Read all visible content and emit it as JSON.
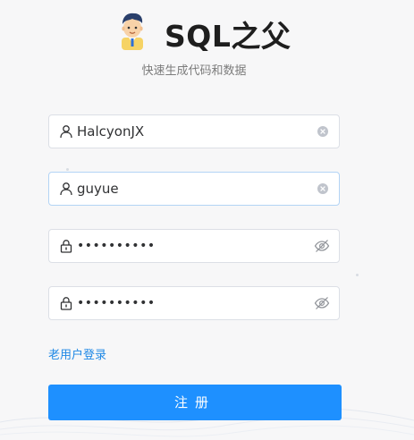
{
  "app": {
    "title": "SQL之父",
    "subtitle": "快速生成代码和数据"
  },
  "form": {
    "username": {
      "value": "HalcyonJX",
      "icon": "user-icon",
      "suffix_icon": "clear-icon"
    },
    "nickname": {
      "value": "guyue",
      "icon": "user-icon",
      "suffix_icon": "clear-icon"
    },
    "password": {
      "value": "••••••••••",
      "icon": "lock-icon",
      "suffix_icon": "eye-off-icon"
    },
    "confirm_password": {
      "value": "••••••••••",
      "icon": "lock-icon",
      "suffix_icon": "eye-off-icon"
    }
  },
  "links": {
    "login": "老用户登录"
  },
  "buttons": {
    "register": "注册"
  },
  "colors": {
    "primary": "#1e90ff",
    "link": "#1e88e5",
    "background": "#f7f7f8"
  }
}
